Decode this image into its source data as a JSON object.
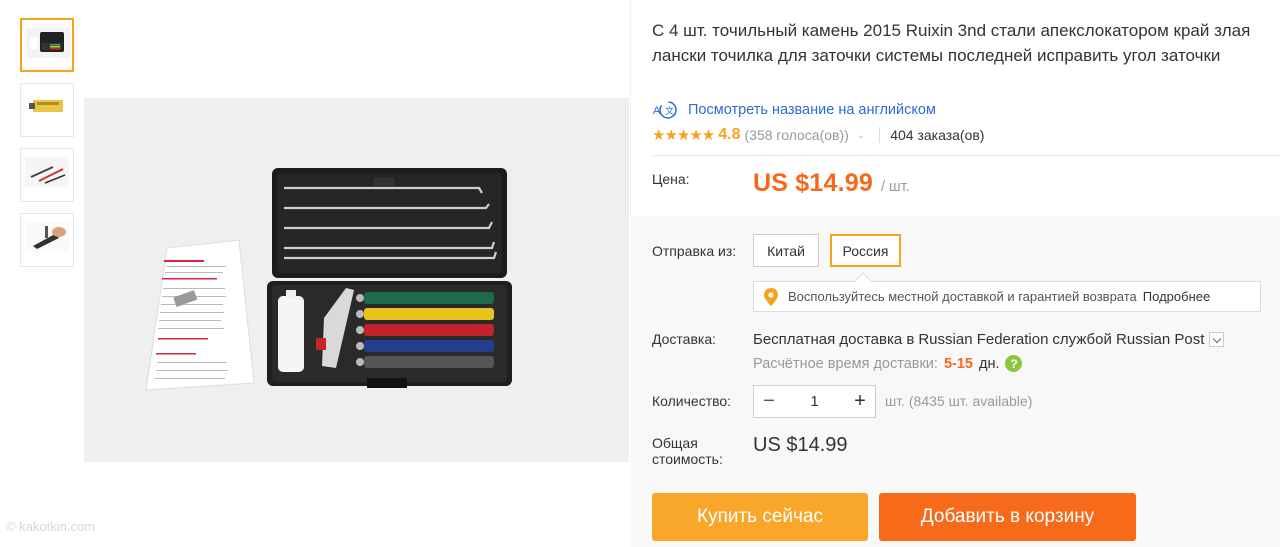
{
  "product": {
    "title": "С 4 шт. точильный камень 2015 Ruixin 3nd стали апекслокатором край злая лански точилка для заточки системы последней исправить угол заточки",
    "translate_link": "Посмотреть название на английском",
    "rating": {
      "stars": "★★★★★",
      "value": "4.8",
      "votes": "(358 голоса(ов))",
      "orders": "404 заказа(ов)"
    }
  },
  "price": {
    "label": "Цена:",
    "value": "US $14.99",
    "unit": "/ шт."
  },
  "shipping": {
    "from_label": "Отправка из:",
    "options": [
      "Китай",
      "Россия"
    ],
    "selected": "Россия",
    "tooltip_text": "Воспользуйтесь местной доставкой и гарантией возврата",
    "tooltip_more": "Подробнее"
  },
  "delivery": {
    "label": "Доставка:",
    "free_text": "Бесплатная доставка в",
    "destination": "Russian Federation",
    "carrier_text": "службой Russian Post",
    "time_label": "Расчётное время доставки:",
    "time_days": "5-15",
    "time_unit": "дн.",
    "help": "?"
  },
  "quantity": {
    "label": "Количество:",
    "minus": "−",
    "value": "1",
    "plus": "+",
    "available": "шт. (8435 шт. available)"
  },
  "total": {
    "label": "Общая стоимость:",
    "value": "US $14.99"
  },
  "actions": {
    "buy_now": "Купить сейчас",
    "add_to_cart": "Добавить в корзину"
  },
  "watermark": "© kakotkin.com",
  "colors": {
    "accent_orange": "#f7a21d",
    "price_orange": "#f7681d",
    "cart_button": "#f76a1a",
    "buy_button": "#f9a72a",
    "link_blue": "#2e6bd2",
    "help_green": "#8cc63f"
  }
}
